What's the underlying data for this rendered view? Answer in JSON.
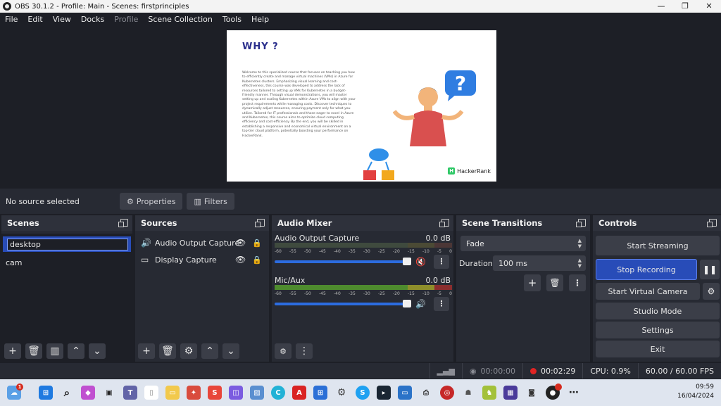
{
  "window": {
    "title": "OBS 30.1.2 - Profile: Main - Scenes: firstprinciples",
    "min": "—",
    "max": "❐",
    "close": "✕"
  },
  "menu": [
    "File",
    "Edit",
    "View",
    "Docks",
    "Profile",
    "Scene Collection",
    "Tools",
    "Help"
  ],
  "preview": {
    "heading": "WHY ?",
    "body": "Welcome to this specialized course that focuses on teaching you how to efficiently create and manage virtual machines (VMs) in Azure for Kubernetes clusters. Emphasizing visual learning and cost-effectiveness, this course was developed to address the lack of resources tailored to setting up VMs for Kubernetes in a budget-friendly manner. Through visual demonstrations, you will master setting up and scaling Kubernetes within Azure VMs to align with your project requirements while managing costs. Discover techniques to dynamically adjust resources, ensuring payment only for what you utilize. Tailored for IT professionals and those eager to excel in Azure and Kubernetes, this course aims to optimize cloud computing efficiency and cost-efficiency. By the end, you will be skilled in establishing a responsive and economical virtual environment on a top-tier cloud platform, potentially boosting your performance on HackerRank.",
    "brand": "HackerRank",
    "question_mark": "?"
  },
  "source_bar": {
    "no_source": "No source selected",
    "properties": "Properties",
    "filters": "Filters"
  },
  "scenes": {
    "title": "Scenes",
    "items": [
      "desktop",
      "cam"
    ]
  },
  "sources": {
    "title": "Sources",
    "items": [
      {
        "label": "Audio Output Capture",
        "icon": "speaker-icon"
      },
      {
        "label": "Display Capture",
        "icon": "monitor-icon"
      }
    ]
  },
  "mixer": {
    "title": "Audio Mixer",
    "scale": [
      "-60",
      "-55",
      "-50",
      "-45",
      "-40",
      "-35",
      "-30",
      "-25",
      "-20",
      "-15",
      "-10",
      "-5",
      "0"
    ],
    "channels": [
      {
        "name": "Audio Output Capture",
        "db": "0.0 dB",
        "muted": true
      },
      {
        "name": "Mic/Aux",
        "db": "0.0 dB",
        "muted": false
      }
    ]
  },
  "transitions": {
    "title": "Scene Transitions",
    "type": "Fade",
    "duration_label": "Duration",
    "duration": "100 ms"
  },
  "controls": {
    "title": "Controls",
    "start_streaming": "Start Streaming",
    "stop_recording": "Stop Recording",
    "start_virtual_camera": "Start Virtual Camera",
    "studio_mode": "Studio Mode",
    "settings": "Settings",
    "exit": "Exit"
  },
  "status": {
    "stream_time": "00:00:00",
    "rec_time": "00:02:29",
    "cpu": "CPU: 0.9%",
    "fps": "60.00 / 60.00 FPS"
  },
  "taskbar": {
    "time": "09:59",
    "date": "16/04/2024",
    "notification_count": "1"
  },
  "colors": {
    "accent": "#284cb8",
    "panel": "#272a33",
    "background": "#1d1f26",
    "record": "#e02424"
  }
}
